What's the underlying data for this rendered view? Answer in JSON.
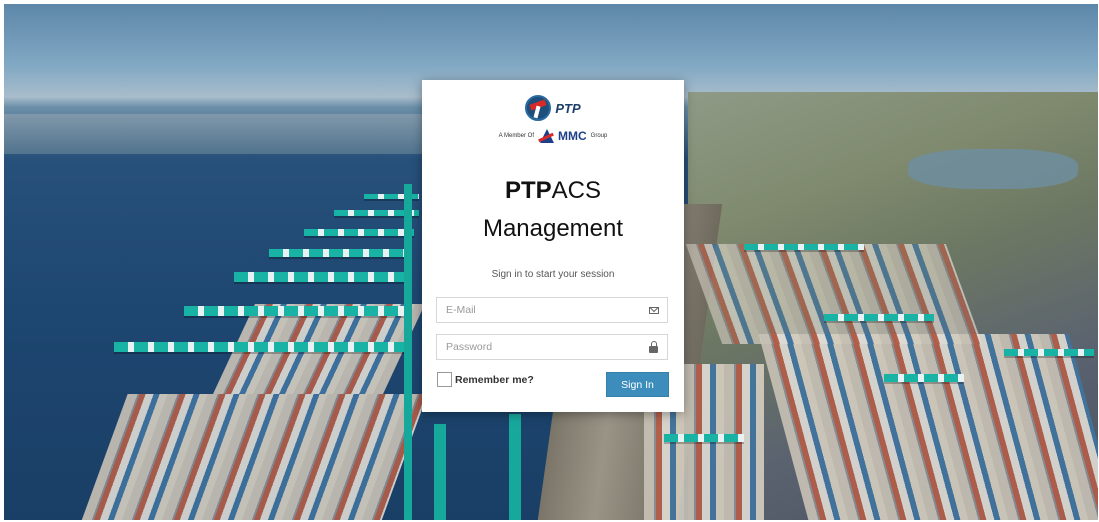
{
  "brand": {
    "logo_text": "PTP",
    "member_prefix": "A Member Of",
    "group_name": "MMC",
    "group_suffix": "Group"
  },
  "title": {
    "bold_part": "PTP",
    "regular_part": "ACS",
    "line2": "Management"
  },
  "subtitle": "Sign in to start your session",
  "form": {
    "email_placeholder": "E-Mail",
    "email_icon": "envelope-icon",
    "password_placeholder": "Password",
    "password_icon": "lock-icon",
    "remember_label": "Remember me?",
    "remember_checked": false,
    "submit_label": "Sign In"
  },
  "colors": {
    "button": "#3c8dbc",
    "brand_blue": "#1e3f6a",
    "brand_red": "#d92a2a"
  }
}
